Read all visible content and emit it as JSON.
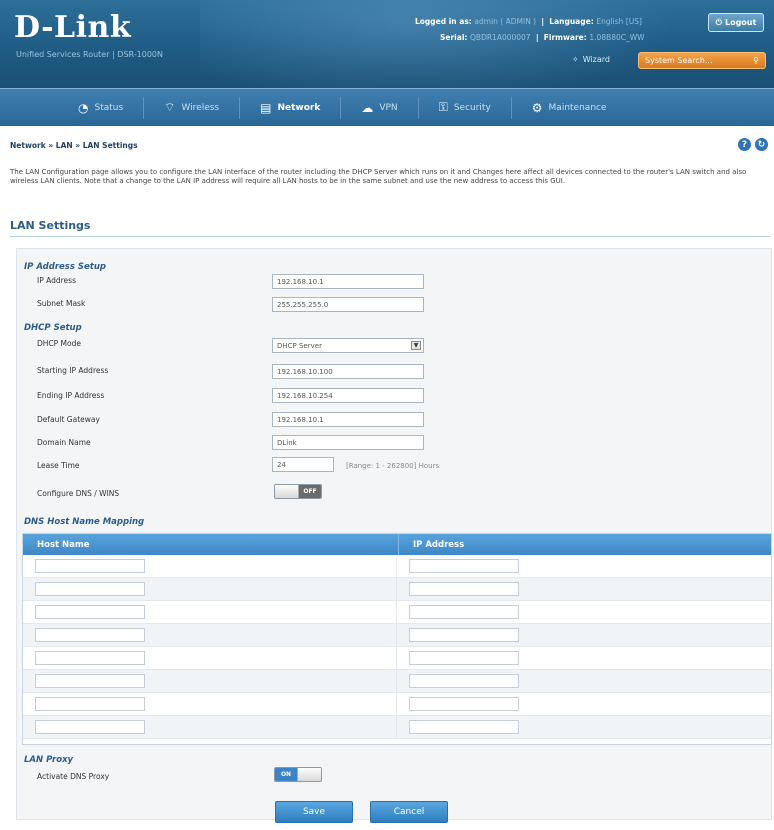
{
  "header": {
    "brand": "D-Link",
    "subtitle": "Unified Services Router  |  DSR-1000N",
    "logged_in_label": "Logged in as:",
    "logged_in_value": "admin ( ADMIN )",
    "language_label": "Language:",
    "language_value": "English [US]",
    "serial_label": "Serial:",
    "serial_value": "QBDR1A000007",
    "firmware_label": "Firmware:",
    "firmware_value": "1.08B80C_WW",
    "logout_label": "Logout",
    "wizard_label": "Wizard",
    "system_search_label": "System Search..."
  },
  "nav": [
    {
      "label": "Status",
      "icon": "dashboard-icon",
      "glyph": "◔"
    },
    {
      "label": "Wireless",
      "icon": "wireless-icon",
      "glyph": "⌔"
    },
    {
      "label": "Network",
      "icon": "network-icon",
      "glyph": "▤",
      "active": true
    },
    {
      "label": "VPN",
      "icon": "cloud-icon",
      "glyph": "☁"
    },
    {
      "label": "Security",
      "icon": "lock-icon",
      "glyph": "⚿"
    },
    {
      "label": "Maintenance",
      "icon": "gear-icon",
      "glyph": "⚙"
    }
  ],
  "breadcrumb": "Network  »  LAN  »  LAN Settings",
  "description": "The LAN Configuration page allows you to configure the LAN interface of the router including the DHCP Server which runs on it and Changes here affect all devices connected to the router's LAN switch and also wireless LAN clients. Note that a change to the LAN IP address will require all LAN hosts to be in the same subnet and use the new address to access this GUI.",
  "section_title": "LAN Settings",
  "ip_setup": {
    "title": "IP Address Setup",
    "ip_label": "IP Address",
    "ip_value": "192.168.10.1",
    "mask_label": "Subnet Mask",
    "mask_value": "255.255.255.0"
  },
  "dhcp": {
    "title": "DHCP Setup",
    "mode_label": "DHCP Mode",
    "mode_value": "DHCP Server",
    "start_label": "Starting IP Address",
    "start_value": "192.168.10.100",
    "end_label": "Ending IP Address",
    "end_value": "192.168.10.254",
    "gateway_label": "Default Gateway",
    "gateway_value": "192.168.10.1",
    "domain_label": "Domain Name",
    "domain_value": "DLink",
    "lease_label": "Lease Time",
    "lease_value": "24",
    "lease_hint": "[Range: 1 - 262800] Hours",
    "dns_wins_label": "Configure DNS / WINS",
    "dns_wins_state": "OFF"
  },
  "dns_mapping": {
    "title": "DNS Host Name Mapping",
    "col_host": "Host Name",
    "col_ip": "IP Address",
    "rows": 8
  },
  "lan_proxy": {
    "title": "LAN Proxy",
    "activate_label": "Activate DNS Proxy",
    "state": "ON"
  },
  "buttons": {
    "save": "Save",
    "cancel": "Cancel"
  }
}
